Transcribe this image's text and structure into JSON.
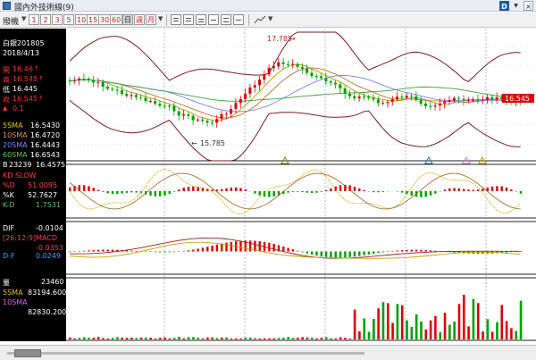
{
  "window": {
    "title": "國內外技術線(9)",
    "btn_d": "D",
    "btn_close": "×"
  },
  "toolbar": {
    "period_label": "撥機",
    "buttons": [
      "1",
      "2",
      "3",
      "5",
      "10",
      "15",
      "30",
      "60",
      "日",
      "週",
      "月"
    ]
  },
  "price_panel": {
    "symbol": "白銀201805",
    "date": "2018/4/13",
    "open_label": "開",
    "open_value": "16.46",
    "high_label": "高",
    "high_value": "16.545",
    "low_label": "低",
    "low_value": "16.445",
    "close_label": "收",
    "close_value": "16.545",
    "change_value": "0.1",
    "sma5_label": "5SMA",
    "sma5_value": "16.5430",
    "sma10_label": "10SMA",
    "sma10_value": "16.4720",
    "sma20_label": "20SMA",
    "sma20_value": "16.4443",
    "sma60_label": "60SMA",
    "sma60_value": "16.6543",
    "b_label": "B",
    "b_value": "23239",
    "b_value2": "16.4575",
    "annot_high": "17.785",
    "annot_low": "15.785",
    "last_price_tag": "16.545"
  },
  "kd_panel": {
    "title": "KD SLOW",
    "d_label": "%D",
    "d_value": "51.0095",
    "k_label": "%K",
    "k_value": "52.7627",
    "kd_label": "K-D",
    "kd_value": "1.7531"
  },
  "macd_panel": {
    "dif_label": "DIF",
    "dif_value": "-0.0104",
    "macd_label": "[26:12:9]MACD",
    "macd_value": "-0.0353",
    "df_label": "D-F",
    "df_value": "0.0249"
  },
  "volume_panel": {
    "title": "量",
    "vol_value": "23460",
    "sma5_label": "5SMA",
    "sma5_value": "83194.600",
    "sma10_label": "10SMA",
    "sma10_value": "82830.200"
  },
  "colors": {
    "up": "#e00000",
    "down": "#00a000",
    "sma5": "#b89a00",
    "sma10": "#c07030",
    "sma20": "#8080ff",
    "sma60": "#40a040",
    "bband": "#7a1a2a",
    "grid": "#333333"
  }
}
